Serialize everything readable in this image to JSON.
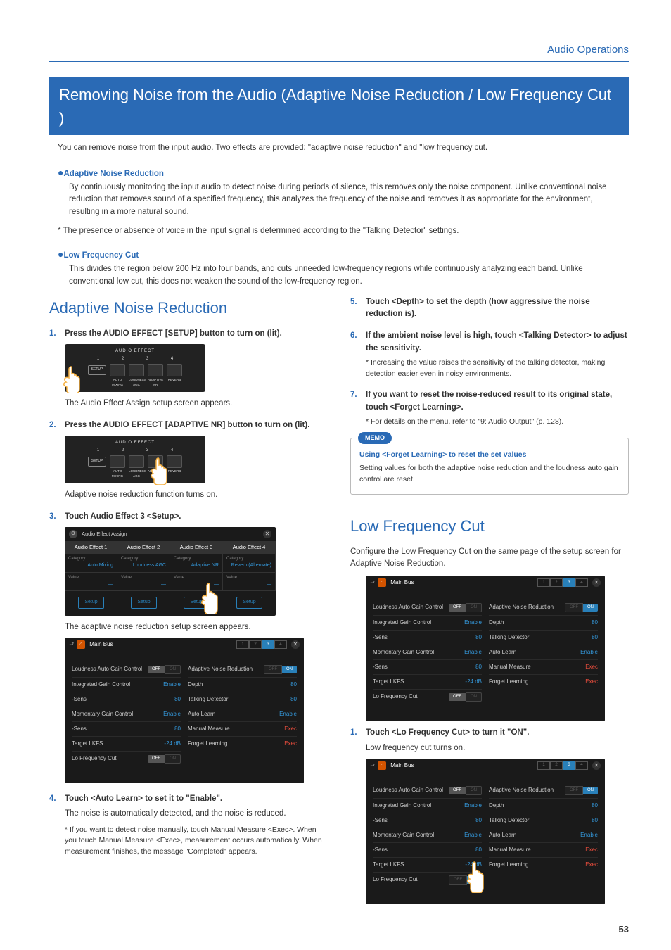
{
  "header": {
    "section": "Audio Operations"
  },
  "title": "Removing Noise from the Audio (Adaptive Noise Reduction / Low Frequency Cut )",
  "intro": "You can remove noise from the input audio. Two effects are provided: \"adaptive noise reduction\" and \"low frequency cut.",
  "adaptive": {
    "heading": "Adaptive Noise Reduction",
    "body": "By continuously monitoring the input audio to detect noise during periods of silence, this removes only the noise component. Unlike conventional noise reduction that removes sound of a specified frequency, this analyzes the frequency of the noise and removes it as appropriate for the environment, resulting in a more natural sound.",
    "star": "The presence or absence of voice in the input signal is determined according to the \"Talking Detector\" settings."
  },
  "lowfreq": {
    "heading": "Low Frequency Cut",
    "body": "This divides the region below 200 Hz into four bands, and cuts unneeded low-frequency regions while continuously analyzing each band. Unlike conventional low cut, this does not weaken the sound of the low-frequency region."
  },
  "left": {
    "section_title": "Adaptive Noise Reduction",
    "s1": {
      "head": "Press the AUDIO EFFECT [SETUP] button to turn on (lit).",
      "caption": "The Audio Effect Assign setup screen appears."
    },
    "s2": {
      "head": "Press the AUDIO EFFECT [ADAPTIVE NR] button to turn on (lit).",
      "caption": "Adaptive noise reduction function turns on."
    },
    "s3": {
      "head": "Touch Audio Effect 3 <Setup>.",
      "caption": "The adaptive noise reduction setup screen appears."
    },
    "s4": {
      "head": "Touch <Auto Learn> to set it to \"Enable\".",
      "body": "The noise is automatically detected, and the noise is reduced.",
      "star": "If you want to detect noise manually, touch Manual Measure <Exec>. When you touch Manual Measure <Exec>, measurement occurs automatically. When measurement finishes, the message \"Completed\" appears."
    }
  },
  "right": {
    "s5": {
      "head": "Touch <Depth> to set the depth (how aggressive the noise reduction is)."
    },
    "s6": {
      "head": "If the ambient noise level is high, touch <Talking Detector> to adjust the sensitivity.",
      "star": "Increasing the value raises the sensitivity of the talking detector, making detection easier even in noisy environments."
    },
    "s7": {
      "head": "If you want to reset the noise-reduced result to its original state, touch <Forget Learning>.",
      "star": "For details on the menu, refer to \"9: Audio Output\" (p. 128)."
    },
    "memo": {
      "badge": "MEMO",
      "sub": "Using <Forget Learning> to reset the set values",
      "body": "Setting values for both the adaptive noise reduction and the loudness auto gain control are reset."
    },
    "lfc_title": "Low Frequency Cut",
    "lfc_intro": "Configure the Low Frequency Cut on the same page of the setup screen for Adaptive Noise Reduction.",
    "lfc_s1": {
      "head": "Touch <Lo Frequency Cut> to turn it \"ON\".",
      "body": "Low frequency cut turns on."
    }
  },
  "hw": {
    "label": "AUDIO EFFECT",
    "nums": [
      "1",
      "2",
      "3",
      "4"
    ],
    "setup": "SETUP",
    "subs": [
      "AUTO MIXING",
      "LOUDNESS AGC",
      "ADAPTIVE NR",
      "REVERB"
    ]
  },
  "assign": {
    "title": "Audio Effect Assign",
    "cols": [
      "Audio Effect 1",
      "Audio Effect 2",
      "Audio Effect 3",
      "Audio Effect 4"
    ],
    "cat_label": "Category",
    "cats": [
      "Auto Mixing",
      "Loudness AGC",
      "Adaptive NR",
      "Reverb (Alternate)"
    ],
    "value_label": "Value",
    "setup": "Setup"
  },
  "screen": {
    "main_bus": "Main Bus",
    "tabs": [
      "1",
      "2",
      "3",
      "4"
    ],
    "left_rows": [
      {
        "label": "Loudness Auto Gain Control",
        "type": "toggle",
        "state": "off"
      },
      {
        "label": "Integrated Gain Control",
        "val": "Enable",
        "cls": "en"
      },
      {
        "label": "-Sens",
        "val": "80",
        "cls": "en"
      },
      {
        "label": "Momentary Gain Control",
        "val": "Enable",
        "cls": "en"
      },
      {
        "label": "-Sens",
        "val": "80",
        "cls": "en"
      },
      {
        "label": "Target LKFS",
        "val": "-24 dB",
        "cls": "en"
      },
      {
        "label": "Lo Frequency Cut",
        "type": "toggle",
        "state": "off"
      }
    ],
    "left_rows_on": [
      {
        "label": "Loudness Auto Gain Control",
        "type": "toggle",
        "state": "off"
      },
      {
        "label": "Integrated Gain Control",
        "val": "Enable",
        "cls": "en"
      },
      {
        "label": "-Sens",
        "val": "80",
        "cls": "en"
      },
      {
        "label": "Momentary Gain Control",
        "val": "Enable",
        "cls": "en"
      },
      {
        "label": "-Sens",
        "val": "80",
        "cls": "en"
      },
      {
        "label": "Target LKFS",
        "val": "-24 dB",
        "cls": "en"
      },
      {
        "label": "Lo Frequency Cut",
        "type": "toggle",
        "state": "on"
      }
    ],
    "right_rows": [
      {
        "label": "Adaptive Noise Reduction",
        "type": "toggle",
        "state": "on"
      },
      {
        "label": "Depth",
        "val": "80",
        "cls": "en"
      },
      {
        "label": "Talking Detector",
        "val": "80",
        "cls": "en"
      },
      {
        "label": "Auto Learn",
        "val": "Enable",
        "cls": "en"
      },
      {
        "label": "Manual Measure",
        "val": "Exec",
        "cls": "red"
      },
      {
        "label": "Forget Learning",
        "val": "Exec",
        "cls": "red"
      }
    ]
  },
  "page": "53"
}
